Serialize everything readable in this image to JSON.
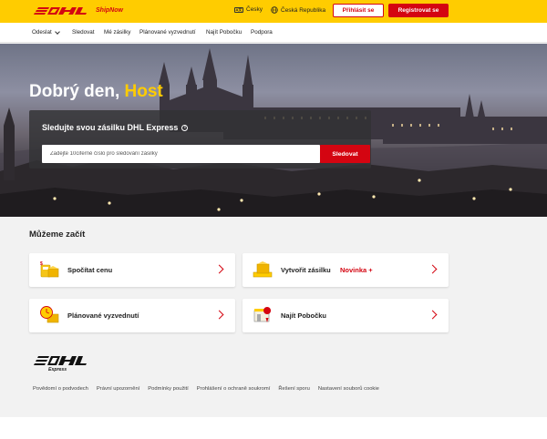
{
  "header": {
    "brand": "DHL",
    "subbrand": "ShipNow",
    "language": "Česky",
    "language_icon": "language-icon",
    "country": "Česká Republika",
    "country_icon": "globe-icon",
    "login_label": "Přihlásit se",
    "register_label": "Registrovat se",
    "brand_color": "#ffcc00",
    "accent_color": "#d40511"
  },
  "nav": {
    "items": [
      {
        "label": "Odeslat",
        "has_dropdown": true
      },
      {
        "label": "Sledovat"
      },
      {
        "label": "Mé zásilky"
      },
      {
        "label": "Plánované vyzvednutí"
      },
      {
        "label": "Najít Pobočku"
      },
      {
        "label": "Podpora"
      }
    ]
  },
  "hero": {
    "greeting": "Dobrý den,",
    "username": "Host",
    "track_title": "Sledujte svou zásilku DHL Express",
    "track_placeholder": "Zadejte 10ciferné číslo pro sledování zásilky",
    "track_value": "",
    "track_button": "Sledovat"
  },
  "start": {
    "title": "Můžeme začít",
    "cards": [
      {
        "label": "Spočítat cenu",
        "icon": "price-calculator-icon"
      },
      {
        "label": "Vytvořit zásilku",
        "badge": "Novinka +",
        "icon": "create-shipment-icon"
      },
      {
        "label": "Plánované vyzvednutí",
        "icon": "scheduled-pickup-icon"
      },
      {
        "label": "Najít Pobočku",
        "icon": "find-location-icon"
      }
    ]
  },
  "footer": {
    "brand": "DHL",
    "express": "Express",
    "links": [
      "Povědomí o podvodech",
      "Právní upozornění",
      "Podmínky použití",
      "Prohlášení o ochraně soukromí",
      "Řešení sporu",
      "Nastavení souborů cookie"
    ]
  }
}
